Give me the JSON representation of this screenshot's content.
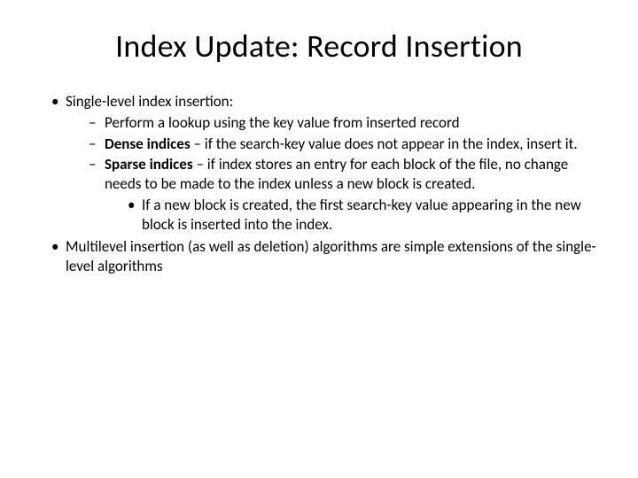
{
  "title": "Index Update: Record Insertion",
  "bullets": {
    "b1": "Single-level index insertion:",
    "b1a": "Perform a lookup using the key value from inserted record",
    "b1b_bold": "Dense indices",
    "b1b_rest": " – if the search-key value does not appear in the index, insert it.",
    "b1c_bold": "Sparse indices",
    "b1c_rest": " – if index stores an entry for each block of the file, no change needs to be made to the index unless a new block is created.",
    "b1c_i": "If a new block is created, the first search-key value appearing in the new block is inserted into the index.",
    "b2": "Multilevel insertion (as well as deletion) algorithms are simple extensions of the single-level algorithms"
  }
}
